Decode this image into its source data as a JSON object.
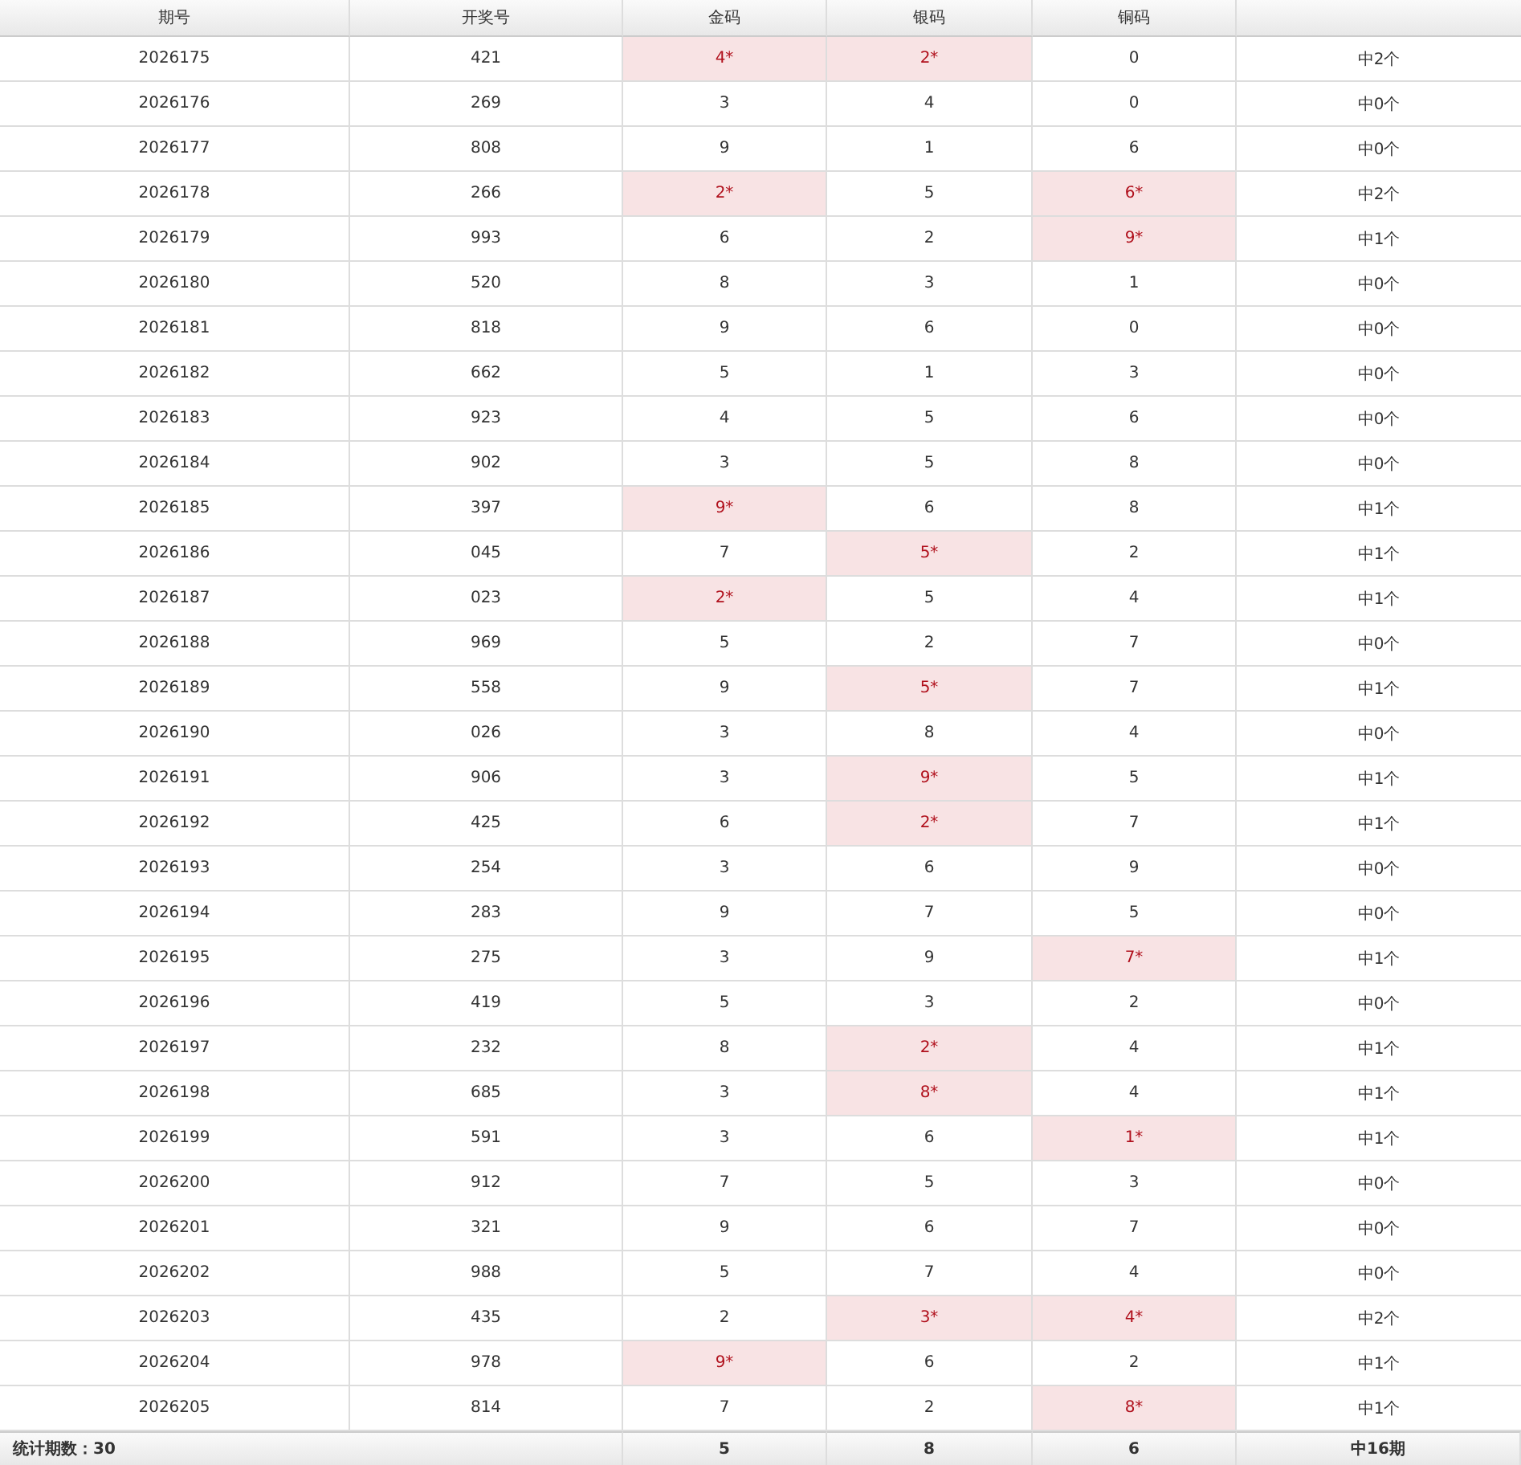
{
  "table": {
    "columns": [
      "期号",
      "开奖号",
      "金码",
      "银码",
      "铜码"
    ],
    "rows": [
      {
        "issue": "2026175",
        "draw": "421",
        "digits": [
          {
            "text": "4*",
            "hit": true
          },
          {
            "text": "2*",
            "hit": true
          },
          {
            "text": "0",
            "hit": false
          }
        ],
        "result": "中2个"
      },
      {
        "issue": "2026176",
        "draw": "269",
        "digits": [
          {
            "text": "3",
            "hit": false
          },
          {
            "text": "4",
            "hit": false
          },
          {
            "text": "0",
            "hit": false
          }
        ],
        "result": "中0个"
      },
      {
        "issue": "2026177",
        "draw": "808",
        "digits": [
          {
            "text": "9",
            "hit": false
          },
          {
            "text": "1",
            "hit": false
          },
          {
            "text": "6",
            "hit": false
          }
        ],
        "result": "中0个"
      },
      {
        "issue": "2026178",
        "draw": "266",
        "digits": [
          {
            "text": "2*",
            "hit": true
          },
          {
            "text": "5",
            "hit": false
          },
          {
            "text": "6*",
            "hit": true
          }
        ],
        "result": "中2个"
      },
      {
        "issue": "2026179",
        "draw": "993",
        "digits": [
          {
            "text": "6",
            "hit": false
          },
          {
            "text": "2",
            "hit": false
          },
          {
            "text": "9*",
            "hit": true
          }
        ],
        "result": "中1个"
      },
      {
        "issue": "2026180",
        "draw": "520",
        "digits": [
          {
            "text": "8",
            "hit": false
          },
          {
            "text": "3",
            "hit": false
          },
          {
            "text": "1",
            "hit": false
          }
        ],
        "result": "中0个"
      },
      {
        "issue": "2026181",
        "draw": "818",
        "digits": [
          {
            "text": "9",
            "hit": false
          },
          {
            "text": "6",
            "hit": false
          },
          {
            "text": "0",
            "hit": false
          }
        ],
        "result": "中0个"
      },
      {
        "issue": "2026182",
        "draw": "662",
        "digits": [
          {
            "text": "5",
            "hit": false
          },
          {
            "text": "1",
            "hit": false
          },
          {
            "text": "3",
            "hit": false
          }
        ],
        "result": "中0个"
      },
      {
        "issue": "2026183",
        "draw": "923",
        "digits": [
          {
            "text": "4",
            "hit": false
          },
          {
            "text": "5",
            "hit": false
          },
          {
            "text": "6",
            "hit": false
          }
        ],
        "result": "中0个"
      },
      {
        "issue": "2026184",
        "draw": "902",
        "digits": [
          {
            "text": "3",
            "hit": false
          },
          {
            "text": "5",
            "hit": false
          },
          {
            "text": "8",
            "hit": false
          }
        ],
        "result": "中0个"
      },
      {
        "issue": "2026185",
        "draw": "397",
        "digits": [
          {
            "text": "9*",
            "hit": true
          },
          {
            "text": "6",
            "hit": false
          },
          {
            "text": "8",
            "hit": false
          }
        ],
        "result": "中1个"
      },
      {
        "issue": "2026186",
        "draw": "045",
        "digits": [
          {
            "text": "7",
            "hit": false
          },
          {
            "text": "5*",
            "hit": true
          },
          {
            "text": "2",
            "hit": false
          }
        ],
        "result": "中1个"
      },
      {
        "issue": "2026187",
        "draw": "023",
        "digits": [
          {
            "text": "2*",
            "hit": true
          },
          {
            "text": "5",
            "hit": false
          },
          {
            "text": "4",
            "hit": false
          }
        ],
        "result": "中1个"
      },
      {
        "issue": "2026188",
        "draw": "969",
        "digits": [
          {
            "text": "5",
            "hit": false
          },
          {
            "text": "2",
            "hit": false
          },
          {
            "text": "7",
            "hit": false
          }
        ],
        "result": "中0个"
      },
      {
        "issue": "2026189",
        "draw": "558",
        "digits": [
          {
            "text": "9",
            "hit": false
          },
          {
            "text": "5*",
            "hit": true
          },
          {
            "text": "7",
            "hit": false
          }
        ],
        "result": "中1个"
      },
      {
        "issue": "2026190",
        "draw": "026",
        "digits": [
          {
            "text": "3",
            "hit": false
          },
          {
            "text": "8",
            "hit": false
          },
          {
            "text": "4",
            "hit": false
          }
        ],
        "result": "中0个"
      },
      {
        "issue": "2026191",
        "draw": "906",
        "digits": [
          {
            "text": "3",
            "hit": false
          },
          {
            "text": "9*",
            "hit": true
          },
          {
            "text": "5",
            "hit": false
          }
        ],
        "result": "中1个"
      },
      {
        "issue": "2026192",
        "draw": "425",
        "digits": [
          {
            "text": "6",
            "hit": false
          },
          {
            "text": "2*",
            "hit": true
          },
          {
            "text": "7",
            "hit": false
          }
        ],
        "result": "中1个"
      },
      {
        "issue": "2026193",
        "draw": "254",
        "digits": [
          {
            "text": "3",
            "hit": false
          },
          {
            "text": "6",
            "hit": false
          },
          {
            "text": "9",
            "hit": false
          }
        ],
        "result": "中0个"
      },
      {
        "issue": "2026194",
        "draw": "283",
        "digits": [
          {
            "text": "9",
            "hit": false
          },
          {
            "text": "7",
            "hit": false
          },
          {
            "text": "5",
            "hit": false
          }
        ],
        "result": "中0个"
      },
      {
        "issue": "2026195",
        "draw": "275",
        "digits": [
          {
            "text": "3",
            "hit": false
          },
          {
            "text": "9",
            "hit": false
          },
          {
            "text": "7*",
            "hit": true
          }
        ],
        "result": "中1个"
      },
      {
        "issue": "2026196",
        "draw": "419",
        "digits": [
          {
            "text": "5",
            "hit": false
          },
          {
            "text": "3",
            "hit": false
          },
          {
            "text": "2",
            "hit": false
          }
        ],
        "result": "中0个"
      },
      {
        "issue": "2026197",
        "draw": "232",
        "digits": [
          {
            "text": "8",
            "hit": false
          },
          {
            "text": "2*",
            "hit": true
          },
          {
            "text": "4",
            "hit": false
          }
        ],
        "result": "中1个"
      },
      {
        "issue": "2026198",
        "draw": "685",
        "digits": [
          {
            "text": "3",
            "hit": false
          },
          {
            "text": "8*",
            "hit": true
          },
          {
            "text": "4",
            "hit": false
          }
        ],
        "result": "中1个"
      },
      {
        "issue": "2026199",
        "draw": "591",
        "digits": [
          {
            "text": "3",
            "hit": false
          },
          {
            "text": "6",
            "hit": false
          },
          {
            "text": "1*",
            "hit": true
          }
        ],
        "result": "中1个"
      },
      {
        "issue": "2026200",
        "draw": "912",
        "digits": [
          {
            "text": "7",
            "hit": false
          },
          {
            "text": "5",
            "hit": false
          },
          {
            "text": "3",
            "hit": false
          }
        ],
        "result": "中0个"
      },
      {
        "issue": "2026201",
        "draw": "321",
        "digits": [
          {
            "text": "9",
            "hit": false
          },
          {
            "text": "6",
            "hit": false
          },
          {
            "text": "7",
            "hit": false
          }
        ],
        "result": "中0个"
      },
      {
        "issue": "2026202",
        "draw": "988",
        "digits": [
          {
            "text": "5",
            "hit": false
          },
          {
            "text": "7",
            "hit": false
          },
          {
            "text": "4",
            "hit": false
          }
        ],
        "result": "中0个"
      },
      {
        "issue": "2026203",
        "draw": "435",
        "digits": [
          {
            "text": "2",
            "hit": false
          },
          {
            "text": "3*",
            "hit": true
          },
          {
            "text": "4*",
            "hit": true
          }
        ],
        "result": "中2个"
      },
      {
        "issue": "2026204",
        "draw": "978",
        "digits": [
          {
            "text": "9*",
            "hit": true
          },
          {
            "text": "6",
            "hit": false
          },
          {
            "text": "2",
            "hit": false
          }
        ],
        "result": "中1个"
      },
      {
        "issue": "2026205",
        "draw": "814",
        "digits": [
          {
            "text": "7",
            "hit": false
          },
          {
            "text": "2",
            "hit": false
          },
          {
            "text": "8*",
            "hit": true
          }
        ],
        "result": "中1个"
      }
    ],
    "footer": {
      "count_label": "统计期数：30",
      "totals": [
        "5",
        "8",
        "6"
      ],
      "summary": "中16期"
    }
  }
}
